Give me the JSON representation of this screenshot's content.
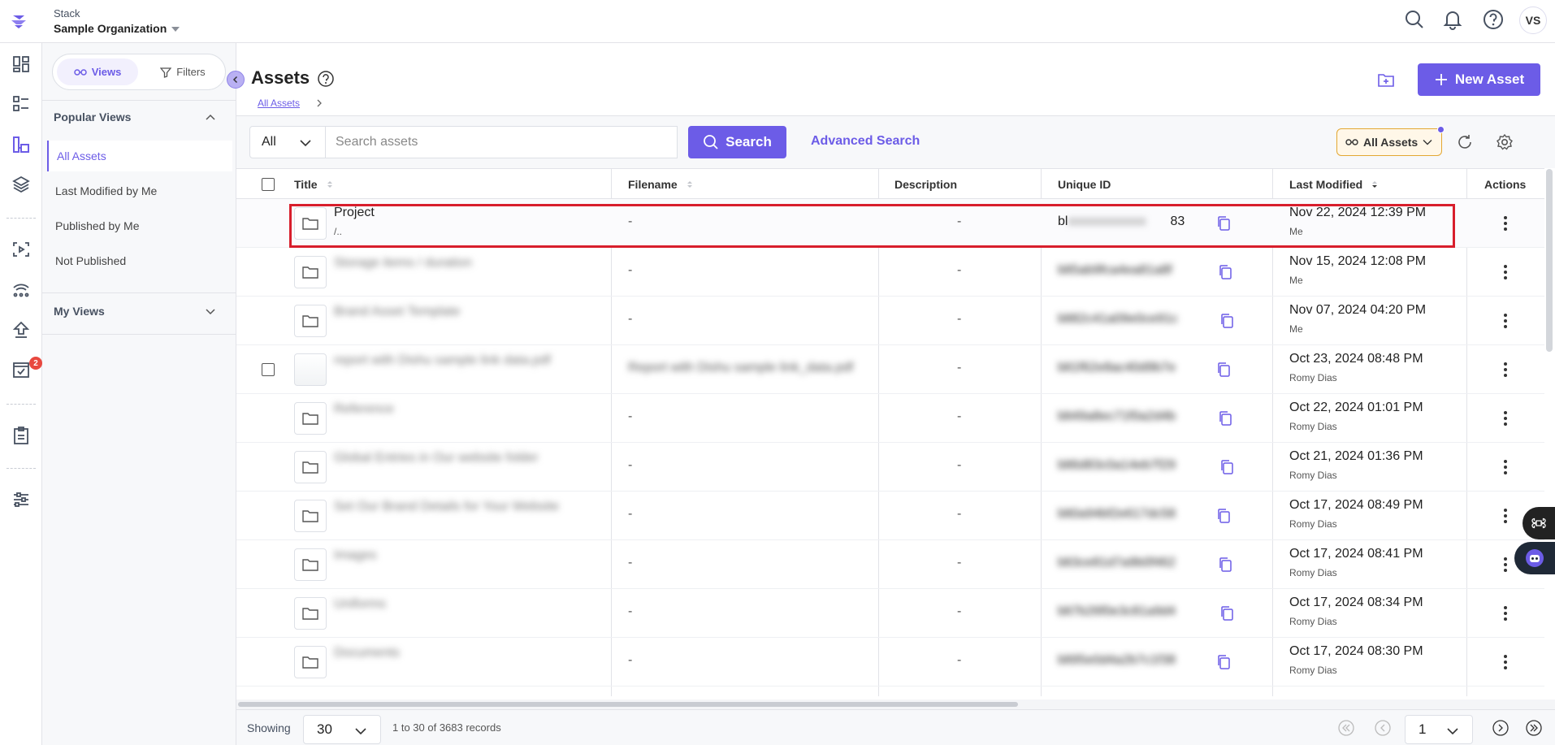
{
  "header": {
    "stack_label": "Stack",
    "org_name": "Sample Organization",
    "icons": [
      "search-icon",
      "bell-icon",
      "help-icon"
    ],
    "avatar_initials": "VS"
  },
  "left_rail": {
    "icons": [
      "dashboard-icon",
      "content-models-icon",
      "assets-icon",
      "entries-icon",
      "releases-icon",
      "workflow-icon",
      "deploy-icon",
      "tasks-icon",
      "audit-log-icon",
      "settings-icon"
    ],
    "tasks_badge": "2"
  },
  "sidebar": {
    "views_label": "Views",
    "filters_label": "Filters",
    "popular_views_title": "Popular Views",
    "popular_views": [
      "All Assets",
      "Last Modified by Me",
      "Published by Me",
      "Not Published"
    ],
    "my_views_title": "My Views"
  },
  "page": {
    "title": "Assets",
    "breadcrumb": "All Assets",
    "new_asset_label": "New Asset"
  },
  "toolbar": {
    "filter_value": "All",
    "search_placeholder": "Search assets",
    "search_label": "Search",
    "advanced_search_label": "Advanced Search",
    "view_chip_label": "All Assets"
  },
  "table": {
    "columns": [
      "Title",
      "Filename",
      "Description",
      "Unique ID",
      "Last Modified",
      "Actions"
    ],
    "rows": [
      {
        "title": "Project",
        "sub": "/..",
        "filename": "-",
        "description": "-",
        "uid": "bl",
        "uid_end": "83",
        "uid_masked": "xxxxxxxxxxxx",
        "date": "Nov 22, 2024 12:39 PM",
        "by": "Me",
        "type": "folder",
        "blurred": false
      },
      {
        "title": "Storage items / duration",
        "sub": "",
        "filename": "-",
        "description": "-",
        "uid": "blt5ab9fca4ea81a8f",
        "date": "Nov 15, 2024 12:08 PM",
        "by": "Me",
        "type": "folder",
        "blurred": true
      },
      {
        "title": "Brand Asset Template",
        "sub": "",
        "filename": "-",
        "description": "-",
        "uid": "blt82c41a09e0ce91c",
        "date": "Nov 07, 2024 04:20 PM",
        "by": "Me",
        "type": "folder",
        "blurred": true
      },
      {
        "title": "report with Dishu sample link data.pdf",
        "sub": "",
        "filename": "Report with Dishu sample link_data.pdf",
        "description": "-",
        "uid": "blt1f62e8ac40d9b7e",
        "date": "Oct 23, 2024 08:48 PM",
        "by": "Romy Dias",
        "type": "file",
        "blurred": true
      },
      {
        "title": "Reference",
        "sub": "",
        "filename": "-",
        "description": "-",
        "uid": "blt49a8ec71f0a2d4b",
        "date": "Oct 22, 2024 01:01 PM",
        "by": "Romy Dias",
        "type": "folder",
        "blurred": true
      },
      {
        "title": "Global Entries in Our website folder",
        "sub": "",
        "filename": "-",
        "description": "-",
        "uid": "blt6d83c0a14eb7f29",
        "date": "Oct 21, 2024 01:36 PM",
        "by": "Romy Dias",
        "type": "folder",
        "blurred": true
      },
      {
        "title": "Set Our Brand Details for Your Website",
        "sub": "",
        "filename": "-",
        "description": "-",
        "uid": "blt0a94bf2e617dc58",
        "date": "Oct 17, 2024 08:49 PM",
        "by": "Romy Dias",
        "type": "folder",
        "blurred": true
      },
      {
        "title": "Images",
        "sub": "",
        "filename": "-",
        "description": "-",
        "uid": "blt3ce81d7a9b0f462",
        "date": "Oct 17, 2024 08:41 PM",
        "by": "Romy Dias",
        "type": "folder",
        "blurred": true
      },
      {
        "title": "Uniforms",
        "sub": "",
        "filename": "-",
        "description": "-",
        "uid": "blt7b26f0e3c81a9d4",
        "date": "Oct 17, 2024 08:34 PM",
        "by": "Romy Dias",
        "type": "folder",
        "blurred": true
      },
      {
        "title": "Documents",
        "sub": "",
        "filename": "-",
        "description": "-",
        "uid": "blt95e0d4a2b7c1f38",
        "date": "Oct 17, 2024 08:30 PM",
        "by": "Romy Dias",
        "type": "folder",
        "blurred": true
      }
    ]
  },
  "footer": {
    "showing_label": "Showing",
    "per_page": "30",
    "records_text": "1 to 30 of 3683 records",
    "current_page": "1"
  },
  "colors": {
    "accent": "#6c5ce7",
    "highlight": "#d81e2c",
    "chip_border": "#e3a732",
    "badge": "#e8483f"
  }
}
